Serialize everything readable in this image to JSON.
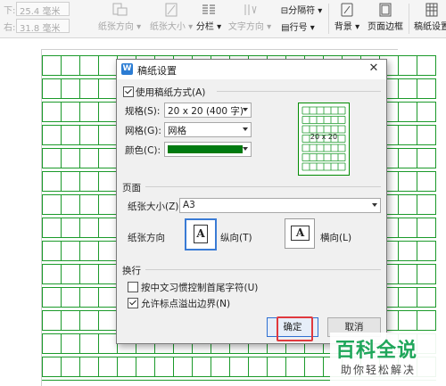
{
  "ribbon": {
    "margin_bottom": {
      "label": "下:",
      "value": "25.4 毫米"
    },
    "margin_right": {
      "label": "右:",
      "value": "31.8 毫米"
    },
    "tools": [
      {
        "id": "paper-direction",
        "label": "纸张方向 ▾",
        "enabled": false
      },
      {
        "id": "paper-size",
        "label": "纸张大小 ▾",
        "enabled": false
      },
      {
        "id": "columns",
        "label": "分栏 ▾",
        "enabled": true
      },
      {
        "id": "text-direction",
        "label": "文字方向 ▾",
        "enabled": false
      },
      {
        "id": "separator",
        "label": "分隔符 ▾",
        "enabled": true
      },
      {
        "id": "line-number",
        "label": "行号 ▾",
        "enabled": true
      },
      {
        "id": "background",
        "label": "背景 ▾",
        "enabled": true
      },
      {
        "id": "page-border",
        "label": "页面边框",
        "enabled": true
      },
      {
        "id": "manuscript-settings",
        "label": "稿纸设置",
        "enabled": true
      }
    ]
  },
  "dialog": {
    "title": "稿纸设置",
    "close_glyph": "✕",
    "use_manuscript": {
      "label": "使用稿纸方式(A)",
      "checked": true
    },
    "spec": {
      "label": "规格(S):",
      "value": "20 x 20 (400 字)"
    },
    "grid": {
      "label": "网格(G):",
      "value": "网格"
    },
    "color": {
      "label": "颜色(C):",
      "value": "#007a10"
    },
    "preview_label": "20 x 20",
    "page_section": "页面",
    "paper_size": {
      "label": "纸张大小(Z):",
      "value": "A3"
    },
    "orientation": {
      "label": "纸张方向",
      "portrait": "纵向(T)",
      "landscape": "横向(L)",
      "selected": "portrait",
      "glyph": "A"
    },
    "wrap_section": "换行",
    "wrap_chinese": {
      "label": "按中文习惯控制首尾字符(U)",
      "checked": false
    },
    "allow_punct": {
      "label": "允许标点溢出边界(N)",
      "checked": true
    },
    "ok_label": "确定",
    "cancel_label": "取消"
  },
  "watermark": {
    "title": "百科全说",
    "subtitle": "助你轻松解决"
  },
  "colors": {
    "grid_green": "#1b9a2a",
    "accent_blue": "#3a7bd5",
    "highlight_red": "#e0393e"
  }
}
